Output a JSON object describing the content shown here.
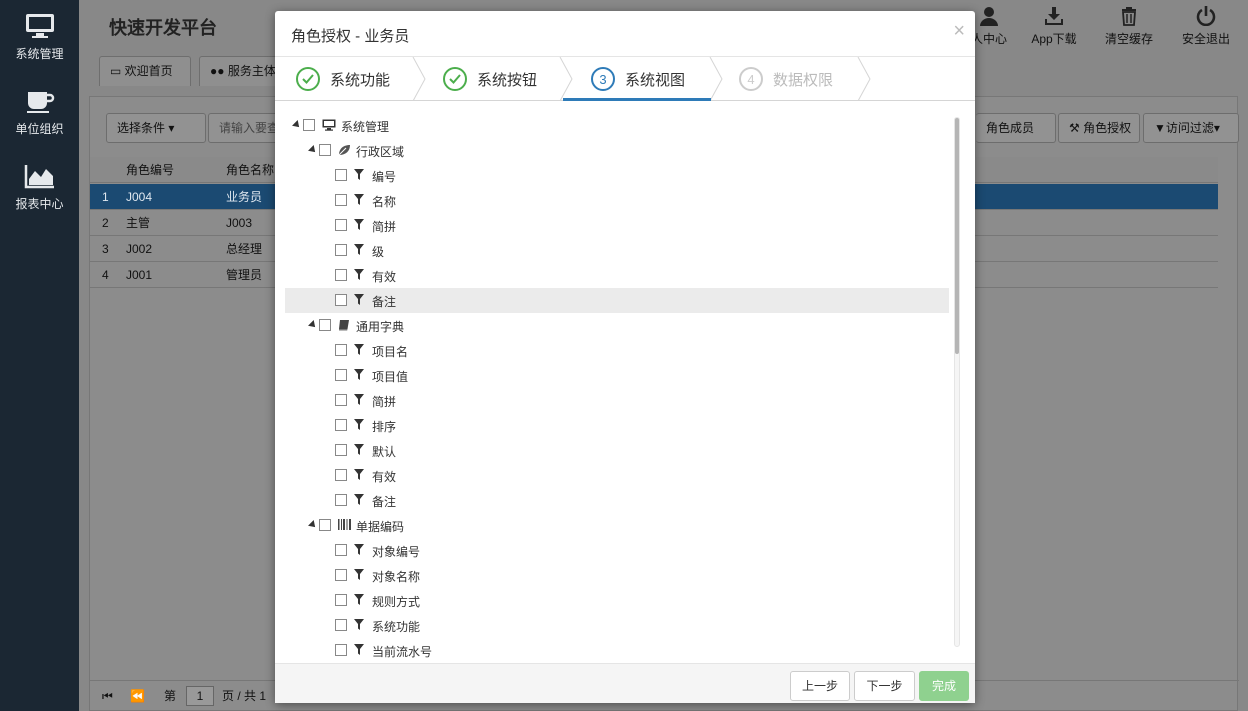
{
  "sidebar": {
    "items": [
      {
        "label": "系统管理",
        "icon": "monitor-icon"
      },
      {
        "label": "单位组织",
        "icon": "coffee-cup-icon"
      },
      {
        "label": "报表中心",
        "icon": "area-chart-icon"
      }
    ]
  },
  "header": {
    "brand": "快速开发平台",
    "buttons": [
      {
        "label": "人中心",
        "icon": "user-icon"
      },
      {
        "label": "App下载",
        "icon": "download-icon"
      },
      {
        "label": "清空缓存",
        "icon": "trash-icon"
      },
      {
        "label": "安全退出",
        "icon": "power-icon"
      }
    ]
  },
  "tabs": [
    {
      "label": "欢迎首页",
      "icon": "desktop-icon"
    },
    {
      "label": "服务主体",
      "icon": "users-icon"
    }
  ],
  "toolbar": {
    "filter_label": "选择条件",
    "search_placeholder": "请输入要查",
    "buttons": [
      {
        "label": "角色成员"
      },
      {
        "label": "角色授权",
        "icon": "gavel-icon"
      },
      {
        "label": "访问过滤",
        "icon": "filter-icon"
      }
    ]
  },
  "grid": {
    "columns": [
      "角色编号",
      "角色名称"
    ],
    "rows": [
      {
        "num": "1",
        "code": "J004",
        "name": "业务员"
      },
      {
        "num": "2",
        "code": "主管",
        "name": "J003"
      },
      {
        "num": "3",
        "code": "J002",
        "name": "总经理"
      },
      {
        "num": "4",
        "code": "J001",
        "name": "管理员"
      }
    ]
  },
  "pager": {
    "page_prefix": "第",
    "page_value": "1",
    "page_suffix": "页 / 共 1"
  },
  "modal": {
    "title": "角色授权 - 业务员",
    "close": "×",
    "steps": [
      {
        "num": "1",
        "label": "系统功能",
        "state": "done"
      },
      {
        "num": "2",
        "label": "系统按钮",
        "state": "done"
      },
      {
        "num": "3",
        "label": "系统视图",
        "state": "current"
      },
      {
        "num": "4",
        "label": "数据权限",
        "state": "pending"
      }
    ],
    "tree": [
      {
        "label": "系统管理",
        "level": 0,
        "icon": "monitor-icon",
        "expanded": true
      },
      {
        "label": "行政区域",
        "level": 1,
        "icon": "leaf-icon",
        "expanded": true
      },
      {
        "label": "编号",
        "level": 2,
        "icon": "filter-icon"
      },
      {
        "label": "名称",
        "level": 2,
        "icon": "filter-icon"
      },
      {
        "label": "简拼",
        "level": 2,
        "icon": "filter-icon"
      },
      {
        "label": "级",
        "level": 2,
        "icon": "filter-icon"
      },
      {
        "label": "有效",
        "level": 2,
        "icon": "filter-icon"
      },
      {
        "label": "备注",
        "level": 2,
        "icon": "filter-icon",
        "highlighted": true
      },
      {
        "label": "通用字典",
        "level": 1,
        "icon": "book-icon",
        "expanded": true
      },
      {
        "label": "项目名",
        "level": 2,
        "icon": "filter-icon"
      },
      {
        "label": "项目值",
        "level": 2,
        "icon": "filter-icon"
      },
      {
        "label": "简拼",
        "level": 2,
        "icon": "filter-icon"
      },
      {
        "label": "排序",
        "level": 2,
        "icon": "filter-icon"
      },
      {
        "label": "默认",
        "level": 2,
        "icon": "filter-icon"
      },
      {
        "label": "有效",
        "level": 2,
        "icon": "filter-icon"
      },
      {
        "label": "备注",
        "level": 2,
        "icon": "filter-icon"
      },
      {
        "label": "单据编码",
        "level": 1,
        "icon": "barcode-icon",
        "expanded": true
      },
      {
        "label": "对象编号",
        "level": 2,
        "icon": "filter-icon"
      },
      {
        "label": "对象名称",
        "level": 2,
        "icon": "filter-icon"
      },
      {
        "label": "规则方式",
        "level": 2,
        "icon": "filter-icon"
      },
      {
        "label": "系统功能",
        "level": 2,
        "icon": "filter-icon"
      },
      {
        "label": "当前流水号",
        "level": 2,
        "icon": "filter-icon"
      }
    ],
    "footer": {
      "prev": "上一步",
      "next": "下一步",
      "finish": "完成"
    }
  },
  "colors": {
    "sidebar_bg": "#1b2733",
    "step_done": "#4cae4c",
    "step_current": "#2e7bb8",
    "finish_btn": "#8fd18f",
    "row_selected": "#1b4a72"
  }
}
